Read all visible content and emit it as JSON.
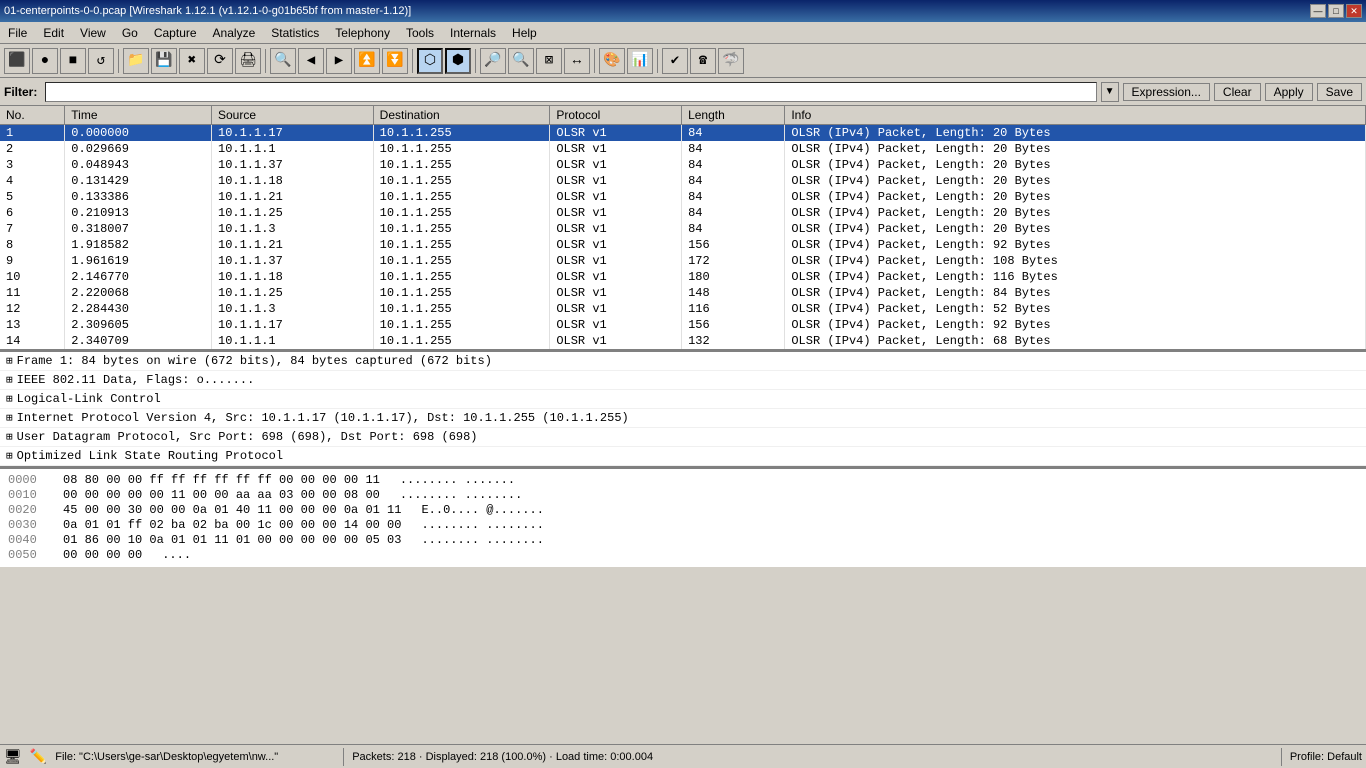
{
  "window": {
    "title": "01-centerpoints-0-0.pcap [Wireshark 1.12.1  (v1.12.1-0-g01b65bf from master-1.12)]",
    "controls": [
      "—",
      "□",
      "✕"
    ]
  },
  "menu": {
    "items": [
      "File",
      "Edit",
      "View",
      "Go",
      "Capture",
      "Analyze",
      "Statistics",
      "Telephony",
      "Tools",
      "Internals",
      "Help"
    ]
  },
  "toolbar": {
    "buttons": [
      {
        "name": "interface-btn",
        "icon": "🖥"
      },
      {
        "name": "start-btn",
        "icon": "●"
      },
      {
        "name": "stop-btn",
        "icon": "◼"
      },
      {
        "name": "restart-btn",
        "icon": "⟳"
      },
      {
        "name": "options-btn",
        "icon": "⚙"
      },
      {
        "name": "open-btn",
        "icon": "📂"
      },
      {
        "name": "save-btn",
        "icon": "💾"
      },
      {
        "name": "close-btn",
        "icon": "✕"
      },
      {
        "name": "reload-btn",
        "icon": "🔃"
      },
      {
        "name": "print-btn",
        "icon": "🖨"
      },
      {
        "name": "find-btn",
        "icon": "🔍"
      },
      {
        "name": "prev-btn",
        "icon": "◄"
      },
      {
        "name": "next-btn",
        "icon": "►"
      },
      {
        "name": "go-btn",
        "icon": "▶"
      },
      {
        "name": "up-btn",
        "icon": "↑"
      },
      {
        "name": "down-btn",
        "icon": "↓"
      },
      {
        "name": "capture-filter-btn",
        "icon": "🎣",
        "active": true
      },
      {
        "name": "display-filter-btn",
        "icon": "🔎",
        "active": true
      },
      {
        "name": "zoom-in-btn",
        "icon": "🔍+"
      },
      {
        "name": "zoom-out-btn",
        "icon": "🔍-"
      },
      {
        "name": "zoom-reset-btn",
        "icon": "1:1"
      },
      {
        "name": "resize-btn",
        "icon": "↔"
      },
      {
        "name": "colorize-btn",
        "icon": "🎨"
      },
      {
        "name": "graph-btn",
        "icon": "📊"
      },
      {
        "name": "checkmark-btn",
        "icon": "✓"
      },
      {
        "name": "phone-btn",
        "icon": "📞"
      },
      {
        "name": "gear-btn",
        "icon": "⚙"
      },
      {
        "name": "wireshark-icon",
        "icon": "🦈"
      }
    ]
  },
  "filterbar": {
    "label": "Filter:",
    "placeholder": "",
    "value": "",
    "buttons": [
      "Expression...",
      "Clear",
      "Apply",
      "Save"
    ]
  },
  "packetlist": {
    "columns": [
      "No.",
      "Time",
      "Source",
      "Destination",
      "Protocol",
      "Length",
      "Info"
    ],
    "rows": [
      {
        "no": "1",
        "time": "0.000000",
        "src": "10.1.1.17",
        "dst": "10.1.1.255",
        "proto": "OLSR v1",
        "len": "84",
        "info": "OLSR (IPv4) Packet,  Length: 20 Bytes",
        "selected": true
      },
      {
        "no": "2",
        "time": "0.029669",
        "src": "10.1.1.1",
        "dst": "10.1.1.255",
        "proto": "OLSR v1",
        "len": "84",
        "info": "OLSR (IPv4) Packet,  Length: 20 Bytes",
        "selected": false
      },
      {
        "no": "3",
        "time": "0.048943",
        "src": "10.1.1.37",
        "dst": "10.1.1.255",
        "proto": "OLSR v1",
        "len": "84",
        "info": "OLSR (IPv4) Packet,  Length: 20 Bytes",
        "selected": false
      },
      {
        "no": "4",
        "time": "0.131429",
        "src": "10.1.1.18",
        "dst": "10.1.1.255",
        "proto": "OLSR v1",
        "len": "84",
        "info": "OLSR (IPv4) Packet,  Length: 20 Bytes",
        "selected": false
      },
      {
        "no": "5",
        "time": "0.133386",
        "src": "10.1.1.21",
        "dst": "10.1.1.255",
        "proto": "OLSR v1",
        "len": "84",
        "info": "OLSR (IPv4) Packet,  Length: 20 Bytes",
        "selected": false
      },
      {
        "no": "6",
        "time": "0.210913",
        "src": "10.1.1.25",
        "dst": "10.1.1.255",
        "proto": "OLSR v1",
        "len": "84",
        "info": "OLSR (IPv4) Packet,  Length: 20 Bytes",
        "selected": false
      },
      {
        "no": "7",
        "time": "0.318007",
        "src": "10.1.1.3",
        "dst": "10.1.1.255",
        "proto": "OLSR v1",
        "len": "84",
        "info": "OLSR (IPv4) Packet,  Length: 20 Bytes",
        "selected": false
      },
      {
        "no": "8",
        "time": "1.918582",
        "src": "10.1.1.21",
        "dst": "10.1.1.255",
        "proto": "OLSR v1",
        "len": "156",
        "info": "OLSR (IPv4) Packet,  Length: 92 Bytes",
        "selected": false
      },
      {
        "no": "9",
        "time": "1.961619",
        "src": "10.1.1.37",
        "dst": "10.1.1.255",
        "proto": "OLSR v1",
        "len": "172",
        "info": "OLSR (IPv4) Packet,  Length: 108 Bytes",
        "selected": false
      },
      {
        "no": "10",
        "time": "2.146770",
        "src": "10.1.1.18",
        "dst": "10.1.1.255",
        "proto": "OLSR v1",
        "len": "180",
        "info": "OLSR (IPv4) Packet,  Length: 116 Bytes",
        "selected": false
      },
      {
        "no": "11",
        "time": "2.220068",
        "src": "10.1.1.25",
        "dst": "10.1.1.255",
        "proto": "OLSR v1",
        "len": "148",
        "info": "OLSR (IPv4) Packet,  Length: 84 Bytes",
        "selected": false
      },
      {
        "no": "12",
        "time": "2.284430",
        "src": "10.1.1.3",
        "dst": "10.1.1.255",
        "proto": "OLSR v1",
        "len": "116",
        "info": "OLSR (IPv4) Packet,  Length: 52 Bytes",
        "selected": false
      },
      {
        "no": "13",
        "time": "2.309605",
        "src": "10.1.1.17",
        "dst": "10.1.1.255",
        "proto": "OLSR v1",
        "len": "156",
        "info": "OLSR (IPv4) Packet,  Length: 92 Bytes",
        "selected": false
      },
      {
        "no": "14",
        "time": "2.340709",
        "src": "10.1.1.1",
        "dst": "10.1.1.255",
        "proto": "OLSR v1",
        "len": "132",
        "info": "OLSR (IPv4) Packet,  Length: 68 Bytes",
        "selected": false
      }
    ]
  },
  "packetdetails": {
    "rows": [
      {
        "icon": "⊞",
        "text": "Frame 1: 84 bytes on wire (672 bits), 84 bytes captured (672 bits)"
      },
      {
        "icon": "⊞",
        "text": "IEEE 802.11 Data, Flags: o......."
      },
      {
        "icon": "⊞",
        "text": "Logical-Link Control"
      },
      {
        "icon": "⊞",
        "text": "Internet Protocol Version 4, Src: 10.1.1.17 (10.1.1.17), Dst: 10.1.1.255 (10.1.1.255)"
      },
      {
        "icon": "⊞",
        "text": "User Datagram Protocol, Src Port: 698 (698), Dst Port: 698 (698)"
      },
      {
        "icon": "⊞",
        "text": "Optimized Link State Routing Protocol"
      }
    ]
  },
  "hexdump": {
    "rows": [
      {
        "offset": "0000",
        "bytes": "08 80 00 00  ff ff ff ff   ff ff 00 00  00 00 11",
        "ascii": "........ ......."
      },
      {
        "offset": "0010",
        "bytes": "00 00 00 00  00 11 00 00   aa aa 03 00  00 08 00",
        "ascii": "........ ........"
      },
      {
        "offset": "0020",
        "bytes": "45 00 00 30  00 00 0a 01   40 11 00 00  00 0a 01 11",
        "ascii": "E..0.... @......."
      },
      {
        "offset": "0030",
        "bytes": "0a 01 01 ff  02 ba 02 ba   00 1c 00 00  00 14 00 00",
        "ascii": "........ ........"
      },
      {
        "offset": "0040",
        "bytes": "01 86 00 10  0a 01 01 11   01 00 00 00  00 00 05 03",
        "ascii": "........ ........"
      },
      {
        "offset": "0050",
        "bytes": "00 00 00 00",
        "ascii": "...."
      }
    ]
  },
  "statusbar": {
    "file": "File: \"C:\\Users\\ge-sar\\Desktop\\egyetem\\nw...\"",
    "packets": "Packets: 218 · Displayed: 218 (100.0%) · Load time: 0:00.004",
    "profile": "Profile: Default"
  }
}
